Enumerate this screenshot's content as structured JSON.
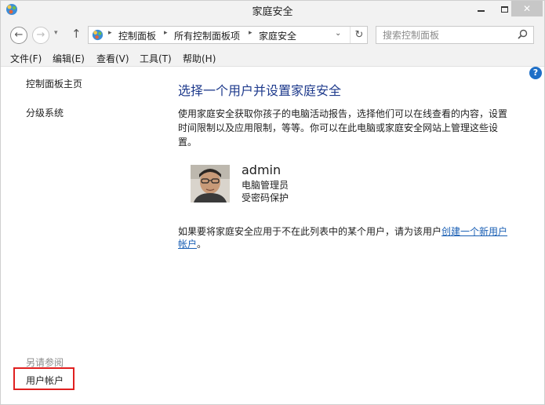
{
  "window": {
    "title": "家庭安全",
    "accent_color": "#1e3a8c"
  },
  "nav": {
    "breadcrumbs": [
      "控制面板",
      "所有控制面板项",
      "家庭安全"
    ],
    "search_placeholder": "搜索控制面板"
  },
  "menu": {
    "items": [
      "文件(F)",
      "编辑(E)",
      "查看(V)",
      "工具(T)",
      "帮助(H)"
    ]
  },
  "sidebar": {
    "links": [
      "控制面板主页",
      "分级系统"
    ],
    "see_also_label": "另请参阅",
    "see_also_links": [
      "用户帐户"
    ]
  },
  "main": {
    "title": "选择一个用户并设置家庭安全",
    "description": "使用家庭安全获取你孩子的电脑活动报告，选择他们可以在线查看的内容，设置时间限制以及应用限制，等等。你可以在此电脑或家庭安全网站上管理这些设置。",
    "user": {
      "name": "admin",
      "role": "电脑管理员",
      "status": "受密码保护"
    },
    "note_prefix": "如果要将家庭安全应用于不在此列表中的某个用户，请为该用户",
    "note_link": "创建一个新用户帐户",
    "note_suffix": "。"
  }
}
